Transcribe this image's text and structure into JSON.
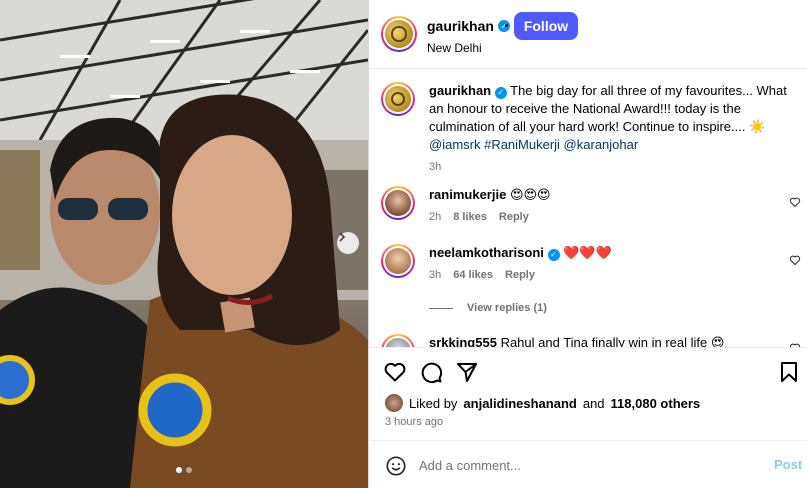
{
  "post": {
    "username": "gaurikhan",
    "location": "New Delhi",
    "follow_label": "Follow",
    "caption_user": "gaurikhan",
    "caption_text": "The big day for all three of my favourites... What an honour to receive the National Award!!! today is the culmination of all your hard work! Continue to inspire.... ☀️",
    "caption_mentions": "@iamsrk #RaniMukerji @karanjohar",
    "caption_time": "3h"
  },
  "comments": [
    {
      "user": "ranimukerjie",
      "text": "😍😍😍",
      "time": "2h",
      "likes": "8 likes",
      "reply": "Reply"
    },
    {
      "user": "neelamkotharisoni",
      "text": "❤️❤️❤️",
      "time": "3h",
      "likes": "64 likes",
      "reply": "Reply"
    },
    {
      "user": "srkking555",
      "text": "Rahul and Tina finally win in real life 😍"
    }
  ],
  "view_replies": "View replies (1)",
  "likes": {
    "prefix": "Liked by",
    "user": "anjalidineshanand",
    "and": "and",
    "count": "118,080 others"
  },
  "post_time": "3 hours ago",
  "add_comment": {
    "placeholder": "Add a comment...",
    "post_label": "Post"
  },
  "colors": {
    "follow": "#4f5bff",
    "link": "#00376b",
    "muted": "#737373",
    "post": "#8fc9f8"
  },
  "icons": [
    "heart-icon",
    "comment-icon",
    "share-icon",
    "bookmark-icon",
    "emoji-icon",
    "chevron-right-icon",
    "verified-icon"
  ]
}
